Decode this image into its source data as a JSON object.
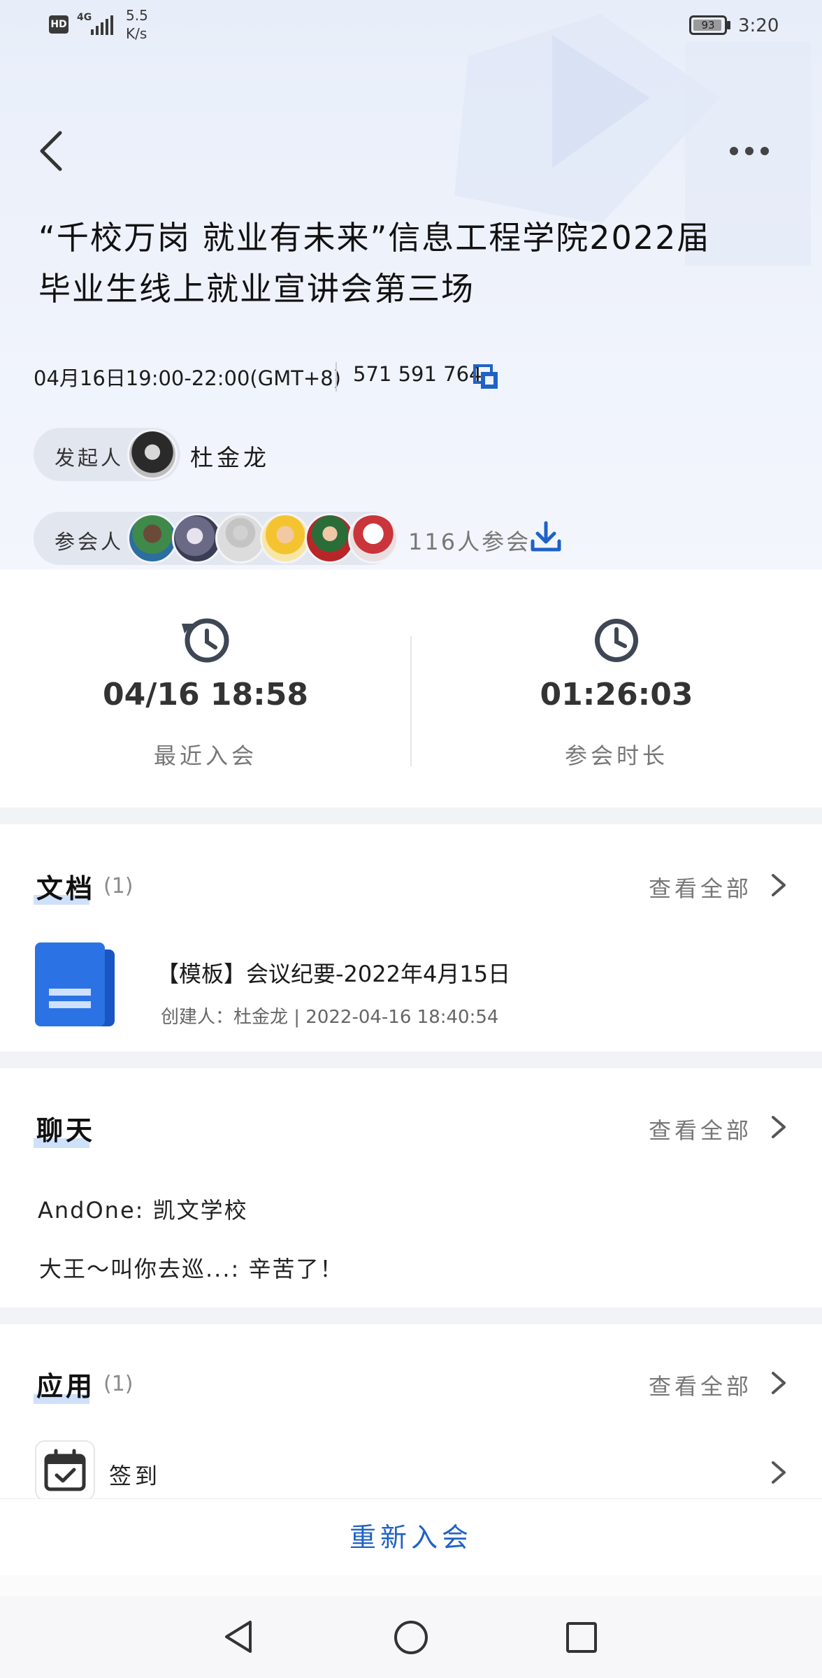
{
  "status_bar": {
    "network": "4G",
    "speed_value": "5.5",
    "speed_unit": "K/s",
    "hd_label": "HD",
    "battery": "93",
    "time": "3:20"
  },
  "header": {
    "back_icon": "chevron-left-icon",
    "more_icon": "more-horizontal-icon"
  },
  "meeting": {
    "title_line1": "“千校万岗 就业有未来”信息工程学院2022届",
    "title_line2": "毕业生线上就业宣讲会第三场",
    "time": "04月16日19:00-22:00(GMT+8)",
    "meeting_id": "571 591 764",
    "organizer_label": "发起人",
    "organizer_name": "杜金龙",
    "participants_label": "参会人",
    "participants_count": "116人参会"
  },
  "stats": {
    "last_join_value": "04/16 18:58",
    "last_join_label": "最近入会",
    "duration_value": "01:26:03",
    "duration_label": "参会时长"
  },
  "documents": {
    "title": "文档",
    "count": "(1)",
    "view_all": "查看全部",
    "items": [
      {
        "name": "【模板】会议纪要-2022年4月15日",
        "meta": "创建人：杜金龙 | 2022-04-16 18:40:54"
      }
    ]
  },
  "chat": {
    "title": "聊天",
    "view_all": "查看全部",
    "messages": [
      "AndOne: 凯文学校",
      "大王～叫你去巡...: 辛苦了！"
    ]
  },
  "apps": {
    "title": "应用",
    "count": "(1)",
    "view_all": "查看全部",
    "items": [
      {
        "name": "签到"
      }
    ]
  },
  "footer": {
    "rejoin_label": "重新入会"
  },
  "colors": {
    "accent": "#1e62c7",
    "doc_icon": "#2b73e4"
  }
}
